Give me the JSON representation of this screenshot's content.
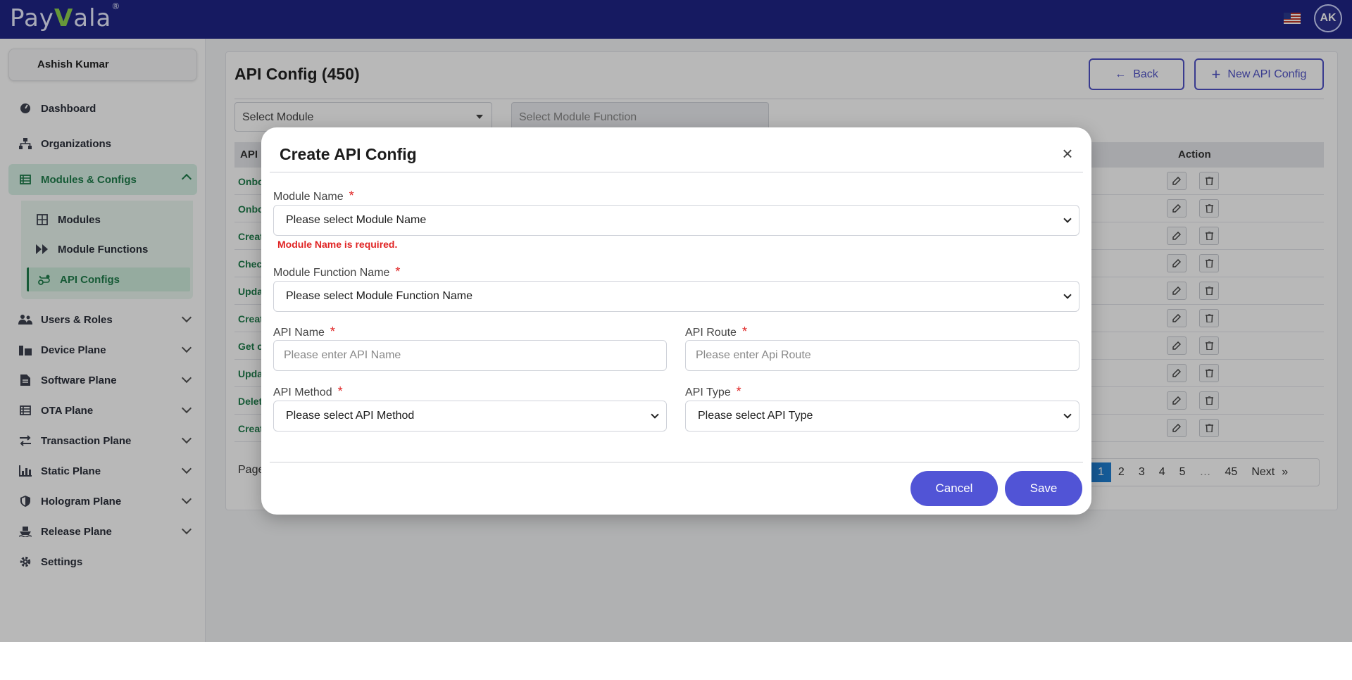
{
  "brand": {
    "logo_text_a": "Pay",
    "logo_text_v": "V",
    "logo_text_b": "ala",
    "registered": "®"
  },
  "header": {
    "avatar_initials": "AK"
  },
  "sidebar": {
    "user_name": "Ashish Kumar",
    "items": [
      {
        "label": "Dashboard"
      },
      {
        "label": "Organizations"
      },
      {
        "label": "Modules & Configs"
      },
      {
        "label": "Users & Roles"
      },
      {
        "label": "Device Plane"
      },
      {
        "label": "Software Plane"
      },
      {
        "label": "OTA Plane"
      },
      {
        "label": "Transaction Plane"
      },
      {
        "label": "Static Plane"
      },
      {
        "label": "Hologram Plane"
      },
      {
        "label": "Release Plane"
      },
      {
        "label": "Settings"
      }
    ],
    "submenu": [
      {
        "label": "Modules"
      },
      {
        "label": "Module Functions"
      },
      {
        "label": "API Configs"
      }
    ]
  },
  "page": {
    "title": "API Config (450)",
    "back_label": "Back",
    "new_label": "New API Config",
    "filter_module": "Select Module",
    "filter_function": "Select Module Function",
    "col_api": "API",
    "col_action": "Action",
    "rows": [
      "Onbo",
      "Onbo",
      "Creat",
      "Check",
      "Upda",
      "Creat",
      "Get c",
      "Upda",
      "Delet",
      "Creat"
    ],
    "page_label": "Page",
    "pager": [
      "1",
      "2",
      "3",
      "4",
      "5",
      "…",
      "45",
      "Next",
      "»"
    ]
  },
  "modal": {
    "title": "Create API Config",
    "close": "×",
    "module_name_label": "Module Name",
    "module_name_value": "Please select Module Name",
    "module_name_error": "Module Name is required.",
    "module_function_label": "Module Function Name",
    "module_function_value": "Please select Module Function Name",
    "api_name_label": "API Name",
    "api_name_placeholder": "Please enter API Name",
    "api_route_label": "API Route",
    "api_route_placeholder": "Please enter Api Route",
    "api_method_label": "API Method",
    "api_method_value": "Please select API Method",
    "api_type_label": "API Type",
    "api_type_value": "Please select API Type",
    "required_mark": "*",
    "cancel_label": "Cancel",
    "save_label": "Save"
  },
  "colors": {
    "topbar": "#1f2587",
    "accent": "#5154d6",
    "active_green": "#1f7d4c",
    "error": "#e02424"
  }
}
